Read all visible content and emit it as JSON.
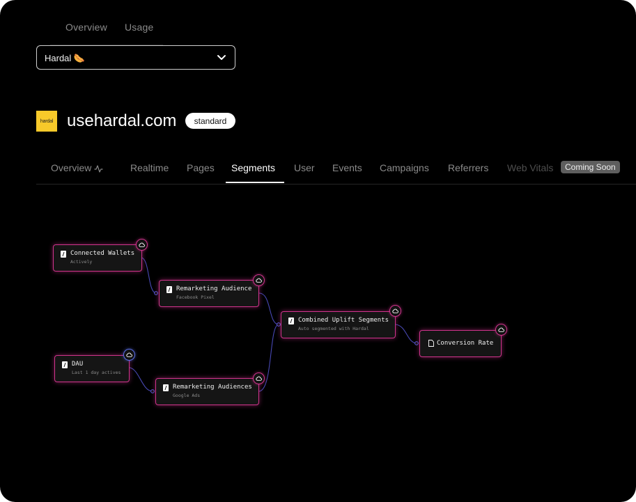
{
  "top_tabs": [
    "Overview",
    "Usage"
  ],
  "project_selector": {
    "value": "Hardal 🌭"
  },
  "site": {
    "logo_text": "hardal",
    "domain": "usehardal.com",
    "plan": "standard"
  },
  "nav": {
    "items": [
      "Overview",
      "Realtime",
      "Pages",
      "Segments",
      "User",
      "Events",
      "Campaigns",
      "Referrers",
      "Web Vitals"
    ],
    "active": "Segments",
    "coming_soon": "Coming Soon"
  },
  "flow": {
    "nodes": [
      {
        "id": "connected-wallets",
        "title": "Connected Wallets",
        "subtitle": "Actively"
      },
      {
        "id": "remarketing-audience",
        "title": "Remarketing Audience",
        "subtitle": "Facebook Pixel"
      },
      {
        "id": "combined-uplift",
        "title": "Combined Uplift Segments",
        "subtitle": "Auto segmented with Hardal"
      },
      {
        "id": "conversion-rate",
        "title": "Conversion Rate",
        "subtitle": ""
      },
      {
        "id": "dau",
        "title": "DAU",
        "subtitle": "Last 1 day actives"
      },
      {
        "id": "remarketing-audiences",
        "title": "Remarketing Audiences",
        "subtitle": "Google Ads"
      }
    ],
    "edges": [
      [
        "connected-wallets",
        "remarketing-audience"
      ],
      [
        "remarketing-audience",
        "combined-uplift"
      ],
      [
        "dau",
        "remarketing-audiences"
      ],
      [
        "remarketing-audiences",
        "combined-uplift"
      ],
      [
        "combined-uplift",
        "conversion-rate"
      ]
    ]
  },
  "colors": {
    "background": "#000000",
    "node_pink": "#d1338c",
    "node_blue": "#4d67e6",
    "logo": "#f7c92a"
  }
}
